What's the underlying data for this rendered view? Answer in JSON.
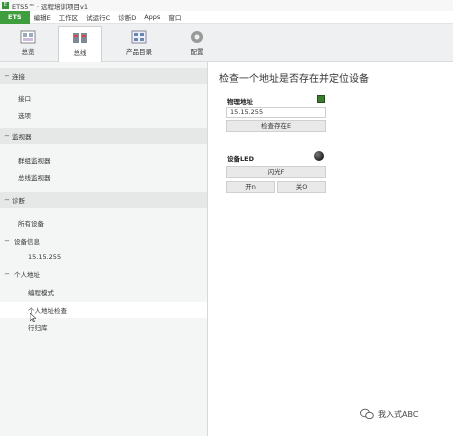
{
  "window": {
    "title": "ETS5™ · 远程培训项目v1",
    "app_icon": "ets-app-icon"
  },
  "menubar": {
    "ets_tab": "ETS",
    "items": [
      "编辑E",
      "工作区",
      "试运行C",
      "诊断D",
      "Apps",
      "窗口"
    ]
  },
  "ribbon": {
    "buttons": [
      {
        "label": "总览",
        "icon": "overview-icon",
        "active": false
      },
      {
        "label": "总线",
        "icon": "bus-icon",
        "active": true
      },
      {
        "label": "产品目录",
        "icon": "catalog-icon",
        "active": false
      },
      {
        "label": "配置",
        "icon": "gear-icon",
        "active": false
      }
    ]
  },
  "sidebar": {
    "sections": [
      {
        "label": "连接",
        "toggle": "−",
        "kind": "header"
      },
      {
        "label": "接口",
        "kind": "item"
      },
      {
        "label": "选项",
        "kind": "item"
      },
      {
        "label": "监视器",
        "toggle": "−",
        "kind": "header"
      },
      {
        "label": "群组监视器",
        "kind": "item"
      },
      {
        "label": "总线监视器",
        "kind": "item"
      },
      {
        "label": "诊断",
        "toggle": "−",
        "kind": "header"
      },
      {
        "label": "所有设备",
        "kind": "item"
      },
      {
        "label": "设备信息",
        "toggle": "−",
        "kind": "item-toggle"
      },
      {
        "label": "15.15.255",
        "kind": "sub"
      },
      {
        "label": "个人地址",
        "toggle": "−",
        "kind": "item-toggle"
      },
      {
        "label": "编程模式",
        "kind": "sub"
      },
      {
        "label": "个人地址检查",
        "kind": "sub",
        "selected": true
      },
      {
        "label": "行归库",
        "kind": "item"
      }
    ]
  },
  "content": {
    "title": "检查一个地址是否存在并定位设备",
    "physical_address_label": "物理地址",
    "physical_address_value": "15.15.255",
    "check_button": "检查存在E",
    "device_led_label": "设备LED",
    "blink_button": "闪光F",
    "on_button": "开n",
    "off_button": "关O"
  },
  "watermark": {
    "text": "我入式ABC",
    "icon": "wechat-icon"
  }
}
